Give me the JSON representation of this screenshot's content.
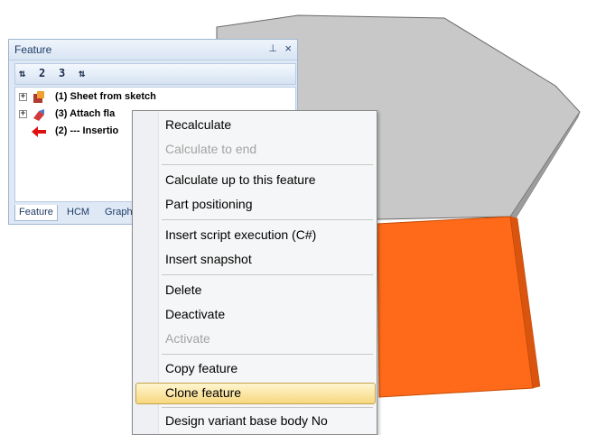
{
  "panel": {
    "title": "Feature",
    "pin_icon": "pin-icon",
    "close_icon": "×",
    "toolbar": {
      "btn1": "⇅",
      "btn2": "2",
      "btn3": "3",
      "btn4": "⇅"
    },
    "tree": [
      {
        "label": "(1) Sheet from sketch",
        "expander": "+",
        "icon": "sheet-icon"
      },
      {
        "label": "(3) Attach fla",
        "expander": "+",
        "icon": "flange-icon"
      },
      {
        "label": "(2) --- Insertio",
        "expander": "",
        "icon": "insertion-arrow-icon"
      }
    ],
    "tabs": [
      "Feature",
      "HCM",
      "Graph"
    ]
  },
  "menu": {
    "items": [
      {
        "label": "Recalculate",
        "enabled": true
      },
      {
        "label": "Calculate to end",
        "enabled": false
      },
      {
        "label": "Calculate up to this feature",
        "enabled": true
      },
      {
        "label": "Part positioning",
        "enabled": true
      },
      {
        "label": "Insert script execution (C#)",
        "enabled": true
      },
      {
        "label": "Insert snapshot",
        "enabled": true
      },
      {
        "label": "Delete",
        "enabled": true
      },
      {
        "label": "Deactivate",
        "enabled": true
      },
      {
        "label": "Activate",
        "enabled": false
      },
      {
        "label": "Copy feature",
        "enabled": true
      },
      {
        "label": "Clone feature",
        "enabled": true,
        "highlighted": true
      },
      {
        "label": "Design variant base body No",
        "enabled": true
      }
    ]
  },
  "colors": {
    "gray_face": "#c8c8c8",
    "orange_face": "#ff6a1a",
    "highlight": "#f7d77f"
  }
}
